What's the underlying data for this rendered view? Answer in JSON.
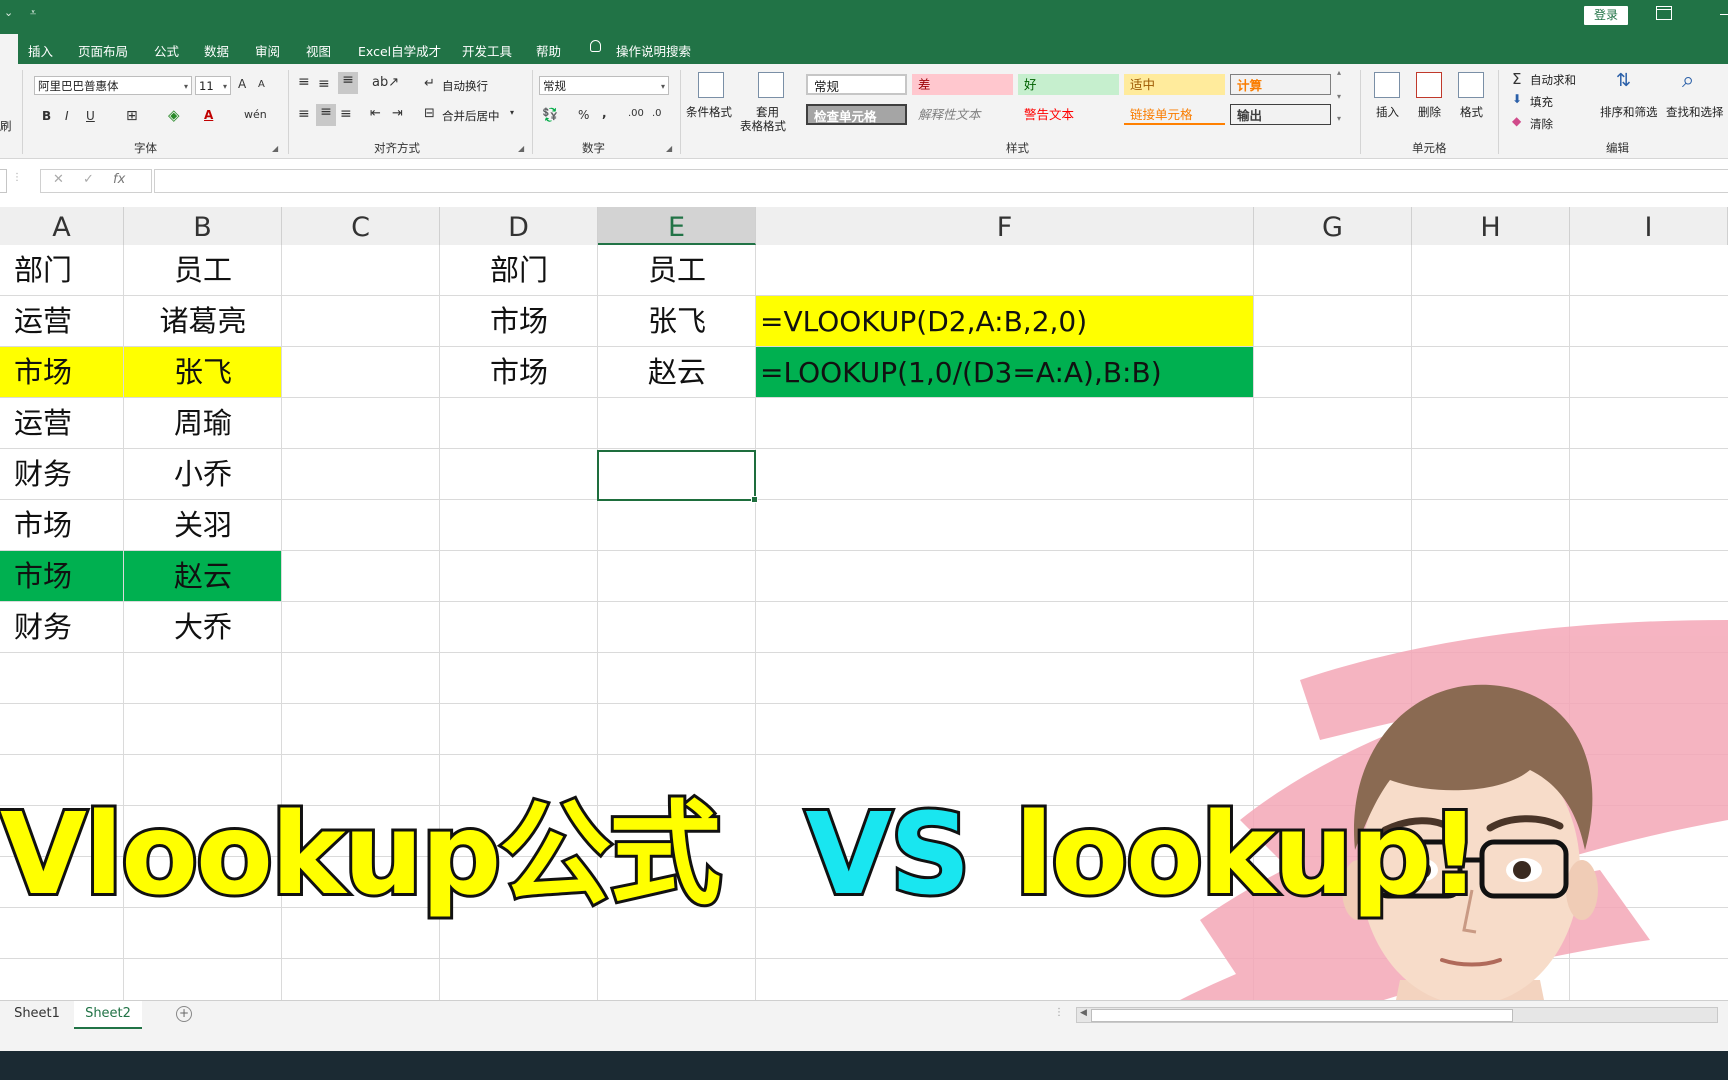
{
  "titlebar": {
    "login_label": "登录"
  },
  "menu": {
    "items": [
      "插入",
      "页面布局",
      "公式",
      "数据",
      "审阅",
      "视图",
      "Excel自学成才",
      "开发工具",
      "帮助",
      "操作说明搜索"
    ]
  },
  "ribbon": {
    "partial_label": "刷",
    "font": {
      "name": "阿里巴巴普惠体",
      "size": "11",
      "bold": "B",
      "italic": "I",
      "underline": "U",
      "grow": "A",
      "shrink": "A",
      "group_label": "字体"
    },
    "alignment": {
      "wrap_text": "自动换行",
      "merge_center": "合并后居中",
      "group_label": "对齐方式"
    },
    "number": {
      "format": "常规",
      "percent": "%",
      "comma": ",",
      "group_label": "数字"
    },
    "styles": {
      "conditional_format": "条件格式",
      "table_format_line1": "套用",
      "table_format_line2": "表格格式",
      "cells": [
        "常规",
        "差",
        "好",
        "适中",
        "计算",
        "检查单元格",
        "解释性文本",
        "警告文本",
        "链接单元格",
        "输出"
      ],
      "group_label": "样式"
    },
    "cells_group": {
      "insert": "插入",
      "delete": "删除",
      "format": "格式",
      "group_label": "单元格"
    },
    "editing": {
      "autosum": "自动求和",
      "fill": "填充",
      "clear": "清除",
      "sort_filter": "排序和筛选",
      "find_select": "查找和选择",
      "group_label": "编辑"
    }
  },
  "formula_bar": {
    "cancel": "✕",
    "enter": "✓",
    "fx": "fx",
    "value": ""
  },
  "grid": {
    "columns": [
      "A",
      "B",
      "C",
      "D",
      "E",
      "F",
      "G",
      "H",
      "I"
    ],
    "selected_column": "E",
    "table1": {
      "headers": [
        "部门",
        "员工"
      ],
      "rows": [
        [
          "运营",
          "诸葛亮"
        ],
        [
          "市场",
          "张飞"
        ],
        [
          "运营",
          "周瑜"
        ],
        [
          "财务",
          "小乔"
        ],
        [
          "市场",
          "关羽"
        ],
        [
          "市场",
          "赵云"
        ],
        [
          "财务",
          "大乔"
        ]
      ]
    },
    "table2": {
      "headers": [
        "部门",
        "员工"
      ],
      "rows": [
        [
          "市场",
          "张飞",
          "=VLOOKUP(D2,A:B,2,0)"
        ],
        [
          "市场",
          "赵云",
          "=LOOKUP(1,0/(D3=A:A),B:B)"
        ]
      ]
    },
    "highlight_colors": {
      "yellow": "#ffff00",
      "green": "#00b050"
    }
  },
  "overlay_title": {
    "part1": "Vlookup公式",
    "part2": "VS",
    "part3": "lookup!"
  },
  "sheets": {
    "tabs": [
      "Sheet1",
      "Sheet2"
    ],
    "active": "Sheet2",
    "add_label": "+"
  },
  "colors": {
    "accent": "#217346",
    "title_yellow": "#ffff00",
    "title_cyan": "#19e6f0"
  }
}
